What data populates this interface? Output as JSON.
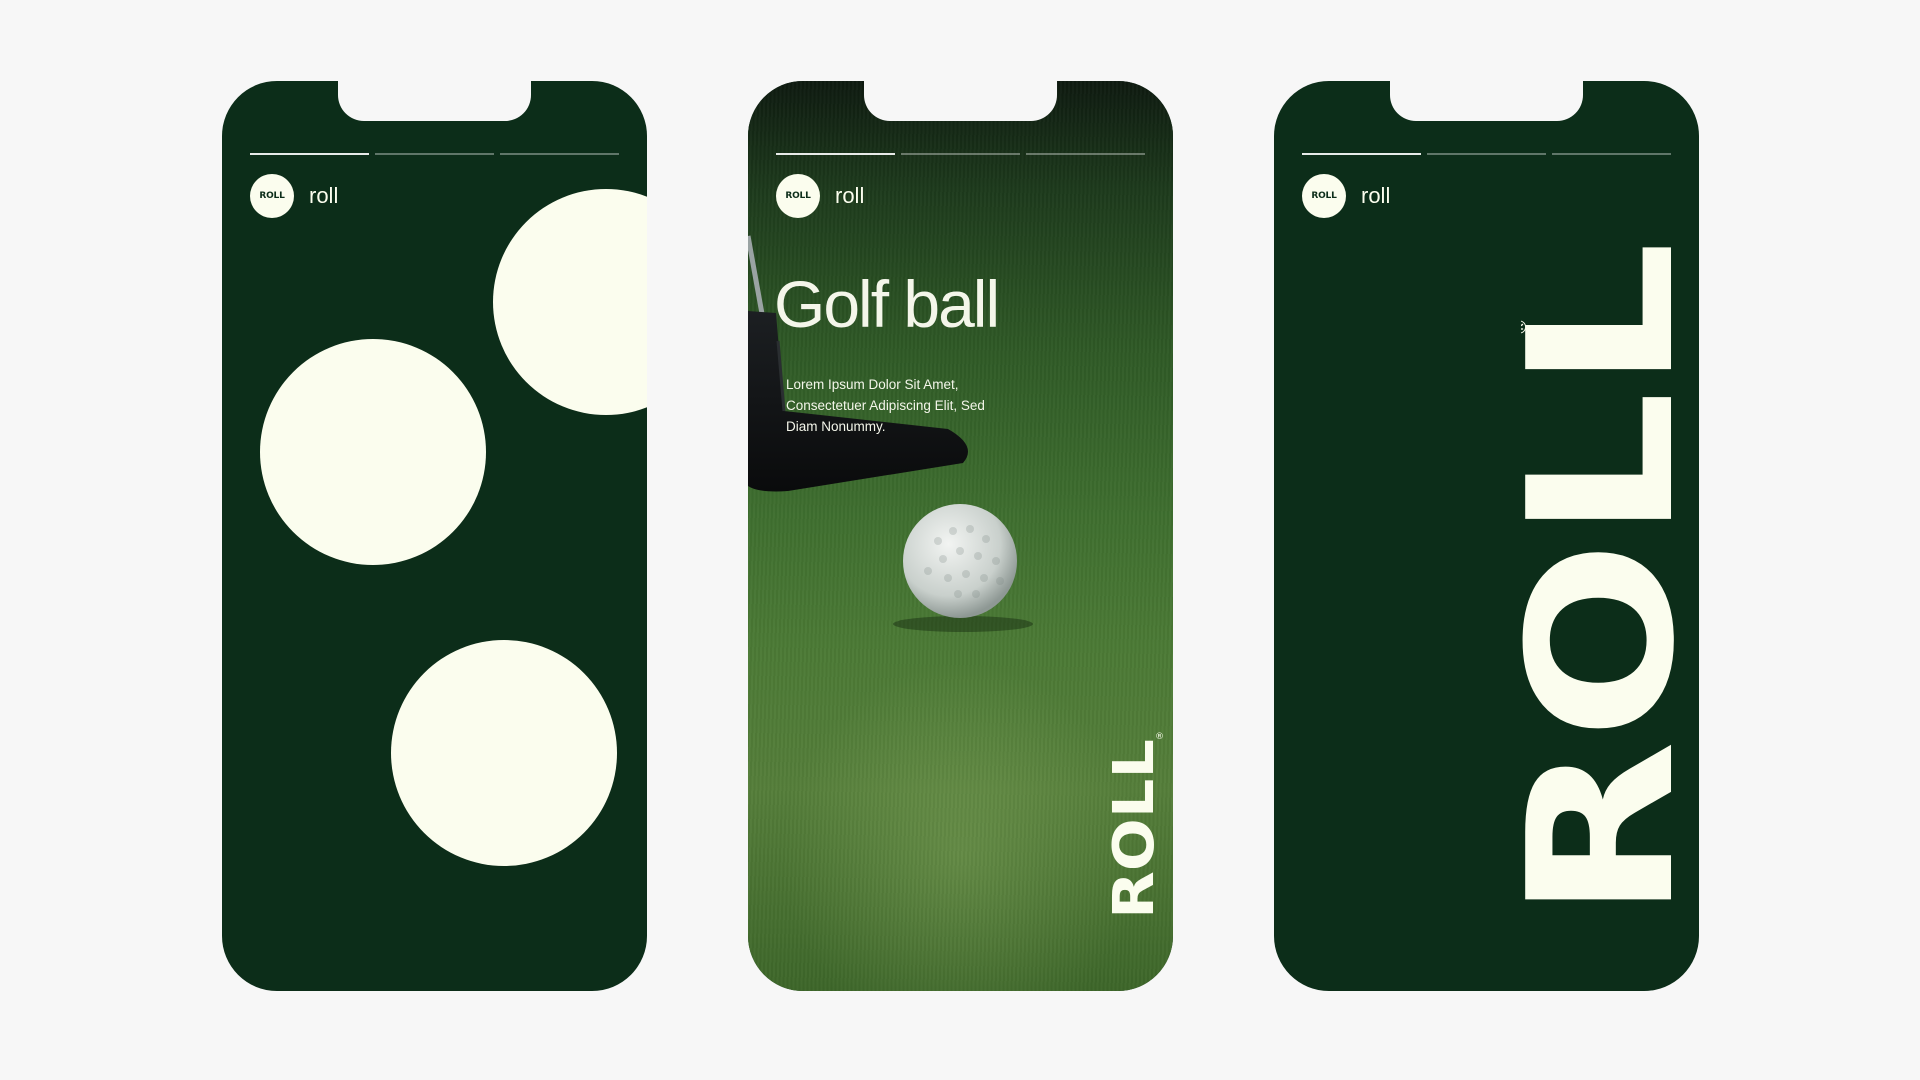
{
  "brand": {
    "avatar_text": "ROLL",
    "handle": "roll"
  },
  "story2": {
    "title": "Golf ball",
    "body": "Lorem Ipsum Dolor Sit Amet, Consectetuer Adipiscing Elit, Sed Diam Nonummy."
  },
  "wordmark": {
    "text": "ROLL",
    "mark": "®"
  },
  "colors": {
    "dark_green": "#0c2d19",
    "cream": "#fbfdee",
    "background": "#f7f7f7"
  },
  "progress_active_segment": 1
}
